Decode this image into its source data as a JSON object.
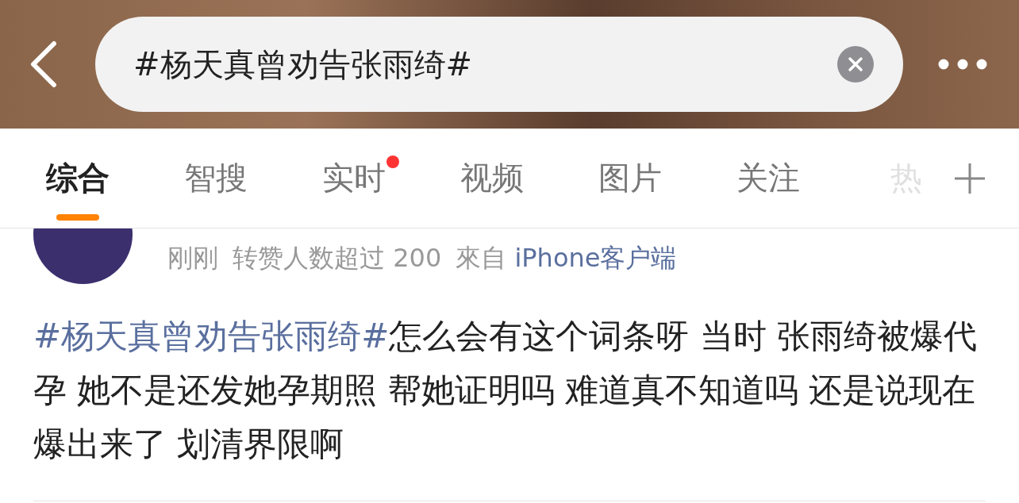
{
  "search": {
    "value": "#杨天真曾劝告张雨绮#"
  },
  "tabs": [
    {
      "label": "综合",
      "selected": true,
      "badge": false,
      "faded": false
    },
    {
      "label": "智搜",
      "selected": false,
      "badge": false,
      "faded": false
    },
    {
      "label": "实时",
      "selected": false,
      "badge": true,
      "faded": false
    },
    {
      "label": "视频",
      "selected": false,
      "badge": false,
      "faded": false
    },
    {
      "label": "图片",
      "selected": false,
      "badge": false,
      "faded": false
    },
    {
      "label": "关注",
      "selected": false,
      "badge": false,
      "faded": false
    },
    {
      "label": "热",
      "selected": false,
      "badge": false,
      "faded": true
    }
  ],
  "post": {
    "time": "刚刚",
    "reposts": "转赞人数超过 200",
    "source_prefix": "來自",
    "source": "iPhone客户端",
    "hashtag": "#杨天真曾劝告张雨绮#",
    "text": "怎么会有这个词条呀 当时 张雨绮被爆代孕 她不是还发她孕期照 帮她证明吗 难道真不知道吗 还是说现在爆出来了 划清界限啊"
  }
}
